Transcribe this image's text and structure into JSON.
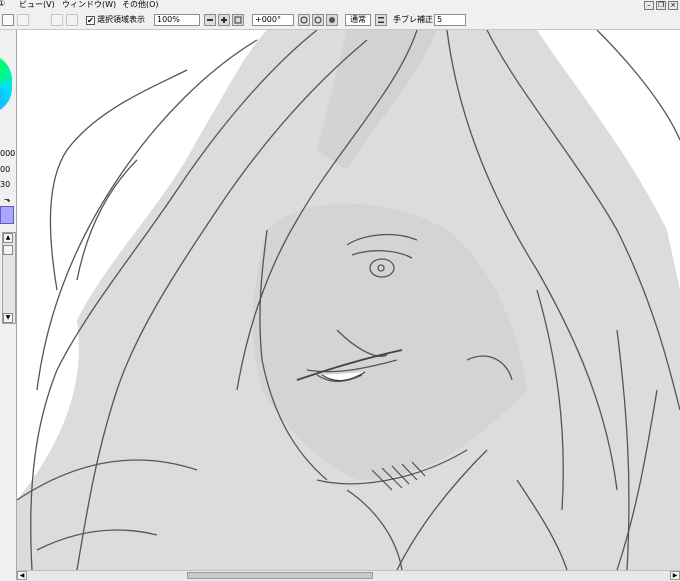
{
  "menu": {
    "item_partial": "①",
    "view": "ビュー(V)",
    "window": "ウィンドウ(W)",
    "other": "その他(O)"
  },
  "toolbar": {
    "show_selection_checked": "✔",
    "show_selection_label": "選択領域表示",
    "zoom_value": "100%",
    "rotation_value": "+000°",
    "blend_mode_label": "通常",
    "stabilizer_label": "手ブレ補正",
    "stabilizer_value": "5"
  },
  "left_panel": {
    "value_1": "000",
    "value_2": "00",
    "value_3": "30",
    "swap_glyph": "⬎",
    "swatch_color": "#a8a8ff"
  },
  "scroll": {
    "horizontal_position": 0.35,
    "horizontal_visible": 0.29
  }
}
